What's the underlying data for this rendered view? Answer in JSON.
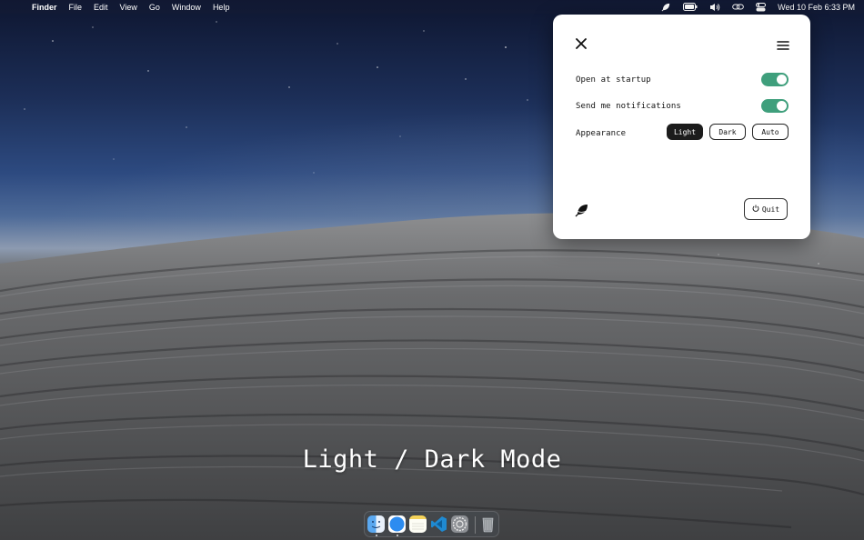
{
  "menubar": {
    "apple_glyph": "",
    "app_name": "Finder",
    "menus": [
      "File",
      "Edit",
      "View",
      "Go",
      "Window",
      "Help"
    ],
    "clock": "Wed 10 Feb  6:33 PM",
    "status_icons": [
      "app-leaf-icon",
      "battery-icon",
      "volume-icon",
      "link-icon",
      "control-center-icon"
    ]
  },
  "popover": {
    "settings": [
      {
        "label": "Open at startup",
        "enabled": true
      },
      {
        "label": "Send me notifications",
        "enabled": true
      }
    ],
    "appearance": {
      "label": "Appearance",
      "options": [
        "Light",
        "Dark",
        "Auto"
      ],
      "selected": "Light"
    },
    "quit_label": "Quit",
    "toggle_color": "#3f9f7c"
  },
  "overlay_title": "Light / Dark Mode",
  "dock": {
    "apps": [
      "finder-icon",
      "safari-icon",
      "notes-icon",
      "vscode-icon",
      "system-preferences-icon",
      "trash-icon"
    ],
    "running": [
      "finder-icon",
      "safari-icon"
    ]
  }
}
